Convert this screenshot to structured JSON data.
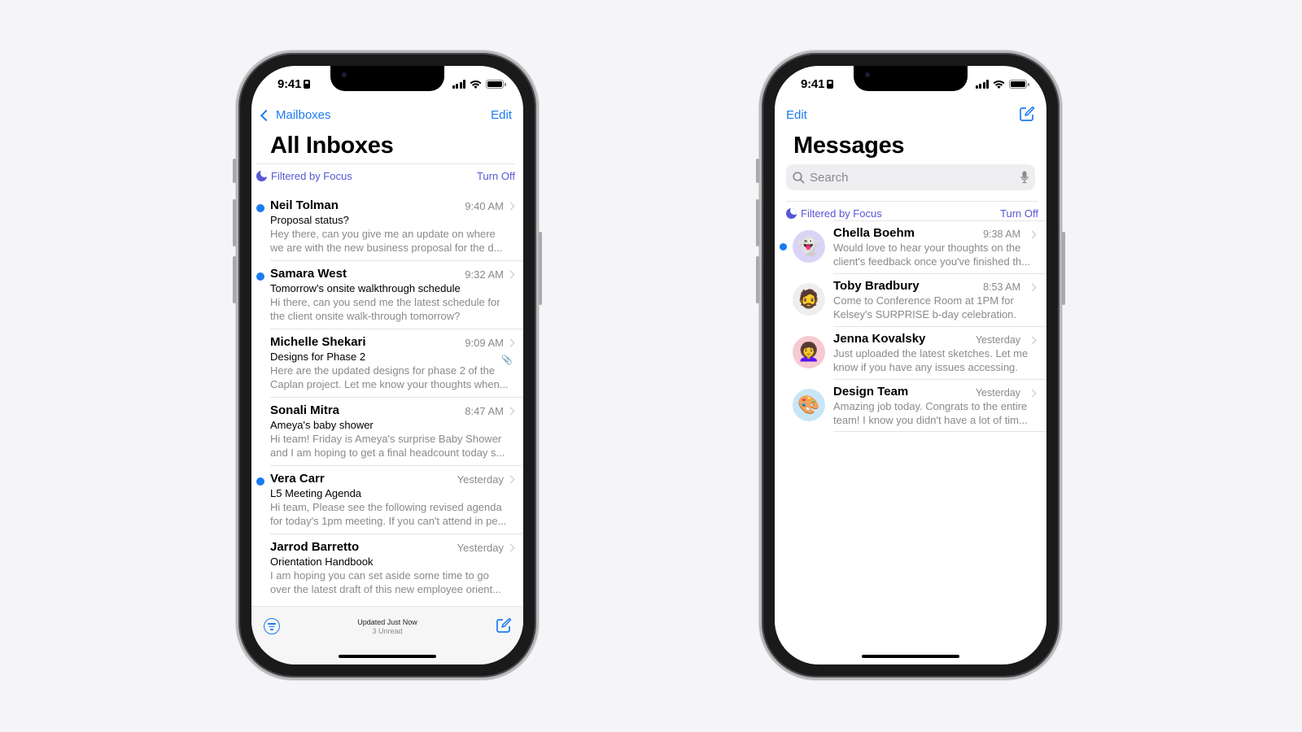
{
  "mail_phone": {
    "status": {
      "time": "9:41"
    },
    "nav": {
      "back_label": "Mailboxes",
      "edit_label": "Edit"
    },
    "title": "All Inboxes",
    "focus": {
      "label": "Filtered by Focus",
      "action": "Turn Off"
    },
    "emails": [
      {
        "sender": "Neil Tolman",
        "time": "9:40 AM",
        "subject": "Proposal status?",
        "preview1": "Hey there, can you give me an update on where",
        "preview2": "we are with the new business proposal for the d...",
        "unread": true,
        "attachment": false
      },
      {
        "sender": "Samara West",
        "time": "9:32 AM",
        "subject": "Tomorrow's onsite walkthrough schedule",
        "preview1": "Hi there, can you send me the latest schedule for",
        "preview2": "the client onsite walk-through tomorrow?",
        "unread": true,
        "attachment": false
      },
      {
        "sender": "Michelle Shekari",
        "time": "9:09 AM",
        "subject": "Designs for Phase 2",
        "preview1": "Here are the updated designs for phase 2 of the",
        "preview2": "Caplan project. Let me know your thoughts when...",
        "unread": false,
        "attachment": true
      },
      {
        "sender": "Sonali Mitra",
        "time": "8:47 AM",
        "subject": "Ameya's baby shower",
        "preview1": "Hi team! Friday is Ameya's surprise Baby Shower",
        "preview2": "and I am hoping to get a final headcount today s...",
        "unread": false,
        "attachment": false
      },
      {
        "sender": "Vera Carr",
        "time": "Yesterday",
        "subject": "L5 Meeting Agenda",
        "preview1": "Hi team, Please see the following revised agenda",
        "preview2": "for today's 1pm meeting. If you can't attend in pe...",
        "unread": true,
        "attachment": false
      },
      {
        "sender": "Jarrod Barretto",
        "time": "Yesterday",
        "subject": "Orientation Handbook",
        "preview1": "I am hoping you can set aside some time to go",
        "preview2": "over the latest draft of this new employee orient...",
        "unread": false,
        "attachment": false
      }
    ],
    "toolbar": {
      "updated": "Updated Just Now",
      "unread": "3 Unread"
    },
    "icons": {
      "back": "chevron-left-icon",
      "focus": "moon-icon",
      "filter": "filter-icon",
      "compose": "compose-icon",
      "attachment": "paperclip-icon"
    }
  },
  "messages_phone": {
    "status": {
      "time": "9:41"
    },
    "nav": {
      "edit_label": "Edit"
    },
    "title": "Messages",
    "search": {
      "placeholder": "Search"
    },
    "focus": {
      "label": "Filtered by Focus",
      "action": "Turn Off"
    },
    "conversations": [
      {
        "name": "Chella Boehm",
        "time": "9:38 AM",
        "preview1": "Would love to hear your thoughts on the",
        "preview2": "client's feedback once you've finished th...",
        "unread": true,
        "avatar": "ghost-memoji",
        "avatar_emoji": "👻",
        "avatar_bg": "#d9d4f5"
      },
      {
        "name": "Toby Bradbury",
        "time": "8:53 AM",
        "preview1": "Come to Conference Room at 1PM for",
        "preview2": "Kelsey's SURPRISE b-day celebration.",
        "unread": false,
        "avatar": "photo",
        "avatar_emoji": "🧔",
        "avatar_bg": "#eeeeee"
      },
      {
        "name": "Jenna Kovalsky",
        "time": "Yesterday",
        "preview1": "Just uploaded the latest sketches. Let me",
        "preview2": "know if you have any issues accessing.",
        "unread": false,
        "avatar": "memoji",
        "avatar_emoji": "👩‍🦱",
        "avatar_bg": "#f7c9d0"
      },
      {
        "name": "Design Team",
        "time": "Yesterday",
        "preview1": "Amazing job today. Congrats to the entire",
        "preview2": "team! I know you didn't have a lot of tim...",
        "unread": false,
        "avatar": "palette",
        "avatar_emoji": "🎨",
        "avatar_bg": "#c9e6f7"
      }
    ],
    "icons": {
      "search": "search-icon",
      "mic": "microphone-icon",
      "compose": "compose-icon",
      "focus": "moon-icon"
    }
  },
  "colors": {
    "accent": "#1a7bf0",
    "focus": "#5856d6",
    "background": "#f5f5f7",
    "secondary_text": "#8a8a8e"
  }
}
